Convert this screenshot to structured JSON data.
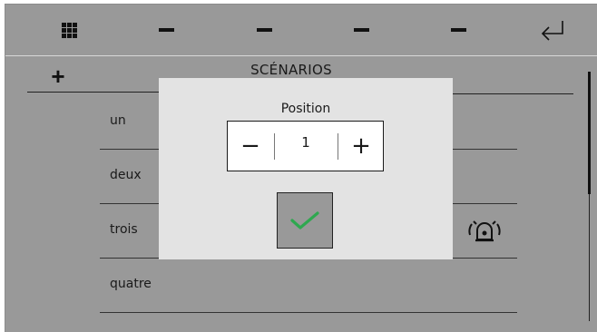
{
  "header": {
    "title": "SCÉNARIOS",
    "add_label": "+",
    "buttons": [
      "grid-icon",
      "minus-icon",
      "minus-icon",
      "minus-icon",
      "minus-icon",
      "return-arrow-icon"
    ]
  },
  "list": {
    "items": [
      {
        "label": "un"
      },
      {
        "label": "deux"
      },
      {
        "label": "trois",
        "icon": "alarm-siren-icon"
      },
      {
        "label": "quatre"
      }
    ]
  },
  "dialog": {
    "title": "Position",
    "value": "1",
    "decrement_label": "−",
    "increment_label": "+",
    "confirm_icon": "checkmark-icon"
  },
  "colors": {
    "background": "#999999",
    "dialog": "#e3e3e3",
    "confirm_check": "#2ea84f"
  }
}
